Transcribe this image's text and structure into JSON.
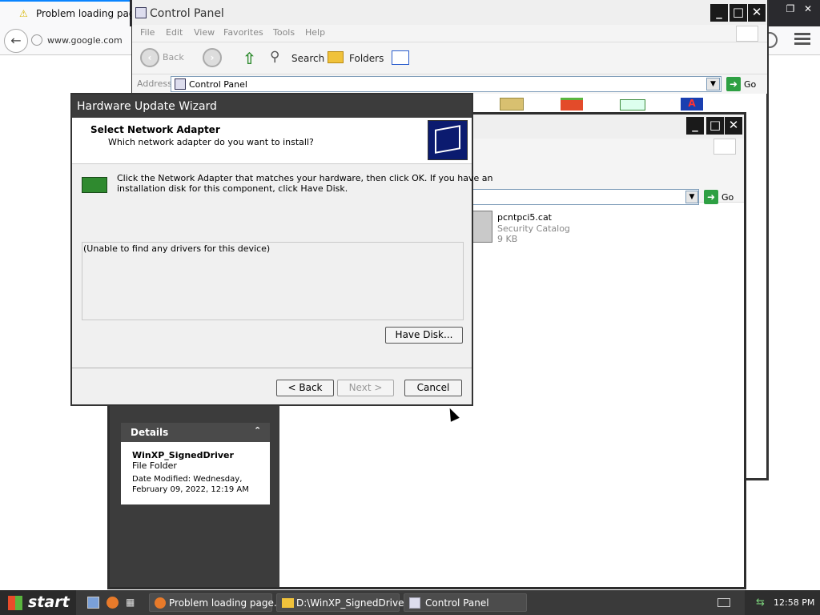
{
  "firefox": {
    "tab_title": "Problem loading page",
    "url": "www.google.com"
  },
  "control_panel": {
    "title": "Control Panel",
    "menu": [
      "File",
      "Edit",
      "View",
      "Favorites",
      "Tools",
      "Help"
    ],
    "toolbar": {
      "back": "Back",
      "search": "Search",
      "folders": "Folders"
    },
    "address_label": "Address",
    "address_value": "Control Panel",
    "go_label": "Go"
  },
  "explorer": {
    "go_label": "Go",
    "file": {
      "name": "pcntpci5.cat",
      "type": "Security Catalog",
      "size": "9 KB"
    },
    "details": {
      "header": "Details",
      "name": "WinXP_SignedDriver",
      "type": "File Folder",
      "modified_line1": "Date Modified: Wednesday,",
      "modified_line2": "February 09, 2022, 12:19 AM"
    }
  },
  "dialog": {
    "title": "Hardware Update Wizard",
    "heading": "Select Network Adapter",
    "subheading": "Which network adapter do you want to install?",
    "instruction_line1": "Click the Network Adapter that matches your hardware, then click OK. If you have an",
    "instruction_line2": "installation disk for this component, click Have Disk.",
    "list_empty_text": "(Unable to find any drivers for this device)",
    "have_disk": "Have Disk...",
    "back": "< Back",
    "next": "Next >",
    "cancel": "Cancel"
  },
  "taskbar": {
    "start": "start",
    "tasks": [
      "Problem loading page...",
      "D:\\WinXP_SignedDriver",
      "Control Panel"
    ],
    "clock": "12:58 PM"
  }
}
